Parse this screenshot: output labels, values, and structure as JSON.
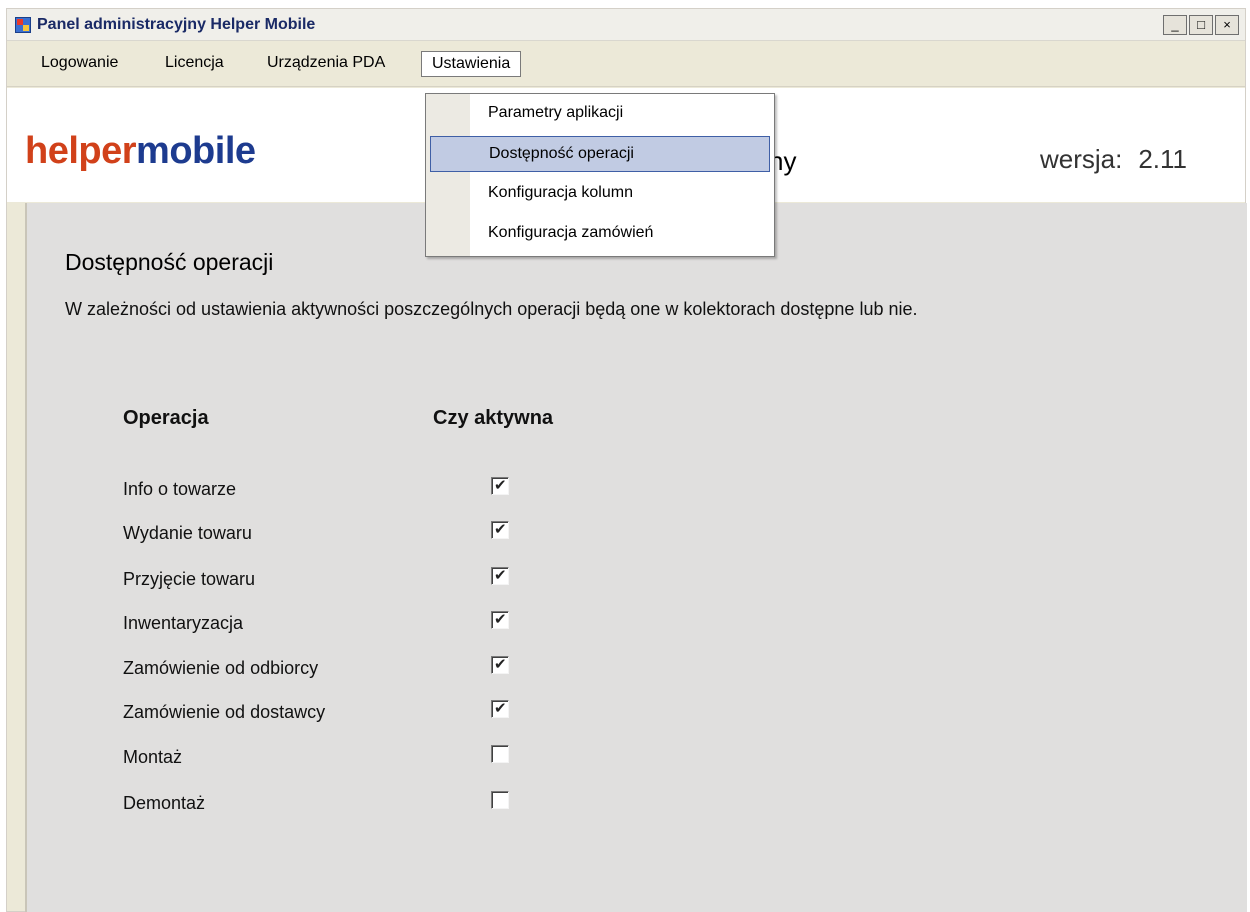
{
  "window": {
    "title": "Panel administracyjny Helper Mobile",
    "controls": [
      "_",
      "□",
      "×"
    ]
  },
  "menubar": {
    "items": [
      "Logowanie",
      "Licencja",
      "Urządzenia PDA",
      "Ustawienia"
    ],
    "active": "Ustawienia"
  },
  "dropdown": {
    "items": [
      "Parametry aplikacji",
      "Dostępność operacji",
      "Konfiguracja kolumn",
      "Konfiguracja zamówień"
    ],
    "highlighted": "Dostępność operacji"
  },
  "header": {
    "logo_part1": "helper",
    "logo_part2": "mobile",
    "title_tail": "ny",
    "version_label": "wersja:",
    "version_value": "2.11"
  },
  "content": {
    "section_title": "Dostępność operacji",
    "description": "W zależności od ustawienia aktywności poszczególnych operacji będą one w kolektorach dostępne lub nie.",
    "col_operation": "Operacja",
    "col_active": "Czy aktywna",
    "operations": [
      {
        "label": "Info o towarze",
        "active": true
      },
      {
        "label": "Wydanie towaru",
        "active": true
      },
      {
        "label": "Przyjęcie towaru",
        "active": true
      },
      {
        "label": "Inwentaryzacja",
        "active": true
      },
      {
        "label": "Zamówienie od odbiorcy",
        "active": true
      },
      {
        "label": "Zamówienie od dostawcy",
        "active": true
      },
      {
        "label": "Montaż",
        "active": false
      },
      {
        "label": "Demontaż",
        "active": false
      }
    ]
  },
  "colors": {
    "logo_orange": "#d1411a",
    "logo_blue": "#1d3b8f",
    "title_text": "#1a2a66",
    "menu_highlight": "#c1cbe3"
  }
}
